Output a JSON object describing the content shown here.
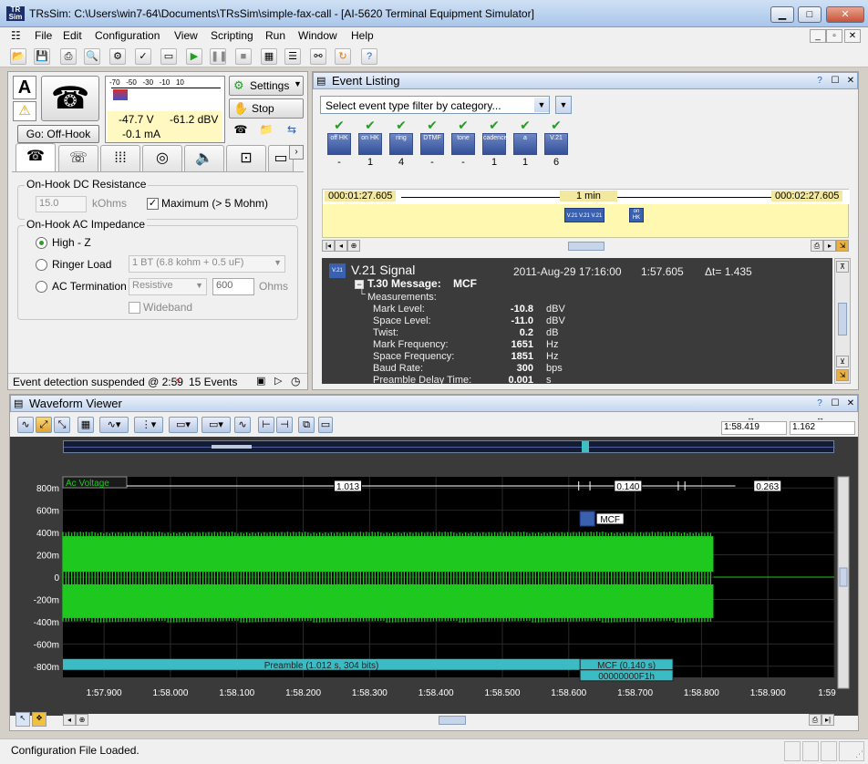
{
  "window": {
    "title": "TRsSim:  C:\\Users\\win7-64\\Documents\\TRsSim\\simple-fax-call - [AI-5620  Terminal Equipment Simulator]",
    "app_icon": "TR Sim"
  },
  "menu": [
    "File",
    "Edit",
    "Configuration",
    "View",
    "Scripting",
    "Run",
    "Window",
    "Help"
  ],
  "phone": {
    "mode_letter": "A",
    "go_button": "Go:  Off-Hook",
    "meter_scale": [
      "-70",
      "-50",
      "-30",
      "-10",
      "10"
    ],
    "meter_level_1": "-47.7  V",
    "meter_level_2": "-0.1 mA",
    "meter_level_3": "-61.2 dBV",
    "settings_button": "Settings",
    "stop_button": "Stop"
  },
  "left_tabs": [
    "phone-icon",
    "handset-icon",
    "keypad-icon",
    "dial-icon",
    "speaker-icon",
    "pulse-icon",
    "more-icon"
  ],
  "onhook_dc": {
    "group_label": "On-Hook DC Resistance",
    "value": "15.0",
    "unit": "kOhms",
    "max_label": "Maximum (> 5 Mohm)"
  },
  "onhook_ac": {
    "group_label": "On-Hook AC Impedance",
    "high_z": "High - Z",
    "ringer_load": "Ringer Load",
    "ringer_value": "1 BT (6.8 kohm + 0.5 uF)",
    "ac_termination": "AC Termination",
    "ac_value": "Resistive",
    "ohms_value": "600",
    "ohms_unit": "Ohms",
    "wideband": "Wideband"
  },
  "left_status": {
    "text": "Event detection suspended @ 2:59",
    "events": "15 Events"
  },
  "event_listing": {
    "title": "Event Listing",
    "filter_placeholder": "Select event type filter by category...",
    "icons": [
      {
        "label": "off HK",
        "count": "-"
      },
      {
        "label": "on HK",
        "count": "1"
      },
      {
        "label": "ring",
        "count": "4"
      },
      {
        "label": "DTMF",
        "count": "-"
      },
      {
        "label": "tone",
        "count": "-"
      },
      {
        "label": "cadence",
        "count": "1"
      },
      {
        "label": "a",
        "count": "1"
      },
      {
        "label": "V.21",
        "count": "6"
      }
    ],
    "timeline_start": "000:01:27.605",
    "timeline_span": "1 min",
    "timeline_end": "000:02:27.605",
    "detail": {
      "title": "V.21 Signal",
      "date": "2011-Aug-29  17:16:00",
      "time": "1:57.605",
      "delta": "Δt= 1.435",
      "message_label": "T.30 Message:",
      "message_value": "MCF",
      "measurements_label": "Measurements:",
      "rows": [
        {
          "name": "Mark Level:",
          "value": "-10.8",
          "unit": "dBV"
        },
        {
          "name": "Space Level:",
          "value": "-11.0",
          "unit": "dBV"
        },
        {
          "name": "Twist:",
          "value": "0.2",
          "unit": "dB"
        },
        {
          "name": "Mark Frequency:",
          "value": "1651",
          "unit": "Hz"
        },
        {
          "name": "Space Frequency:",
          "value": "1851",
          "unit": "Hz"
        },
        {
          "name": "Baud Rate:",
          "value": "300",
          "unit": "bps"
        },
        {
          "name": "Preamble Delay Time:",
          "value": "0.001",
          "unit": "s"
        }
      ]
    }
  },
  "waveform": {
    "title": "Waveform Viewer",
    "cursor_a": "1:58.419",
    "cursor_b": "1.162",
    "trace_label": "Ac Voltage",
    "interval_1": "1.013",
    "interval_2": "0.140",
    "interval_3": "0.263",
    "mcf_tag": "MCF",
    "preamble_bar": "Preamble (1.012 s, 304 bits)",
    "mcf_bar": "MCF (0.140 s)",
    "mcf_hex": "00000000F1h"
  },
  "chart_data": {
    "type": "area",
    "ylabel": "",
    "xlabel": "",
    "series": [
      {
        "name": "Ac Voltage",
        "color": "#1ec81e"
      }
    ],
    "y_ticks": [
      "800m",
      "600m",
      "400m",
      "200m",
      "0",
      "-200m",
      "-400m",
      "-600m",
      "-800m"
    ],
    "y_tick_values": [
      0.8,
      0.6,
      0.4,
      0.2,
      0,
      -0.2,
      -0.4,
      -0.6,
      -0.8
    ],
    "x_ticks": [
      "1:57.900",
      "1:58.000",
      "1:58.100",
      "1:58.200",
      "1:58.300",
      "1:58.400",
      "1:58.500",
      "1:58.600",
      "1:58.700",
      "1:58.800",
      "1:58.900",
      "1:59"
    ],
    "x_tick_values": [
      117.9,
      118.0,
      118.1,
      118.2,
      118.3,
      118.4,
      118.5,
      118.6,
      118.7,
      118.8,
      118.9,
      119.0
    ],
    "xlim": [
      117.838,
      119.0
    ],
    "ylim": [
      -0.9,
      0.9
    ],
    "signal": {
      "start": 117.838,
      "end": 118.818,
      "amplitude": 0.4
    },
    "grid": true
  },
  "status": {
    "text": "Configuration File Loaded."
  },
  "colors": {
    "signal": "#1ec81e",
    "plot_bg": "#000000",
    "bar": "#3bbcc4",
    "accent": "#2e6fbe"
  }
}
